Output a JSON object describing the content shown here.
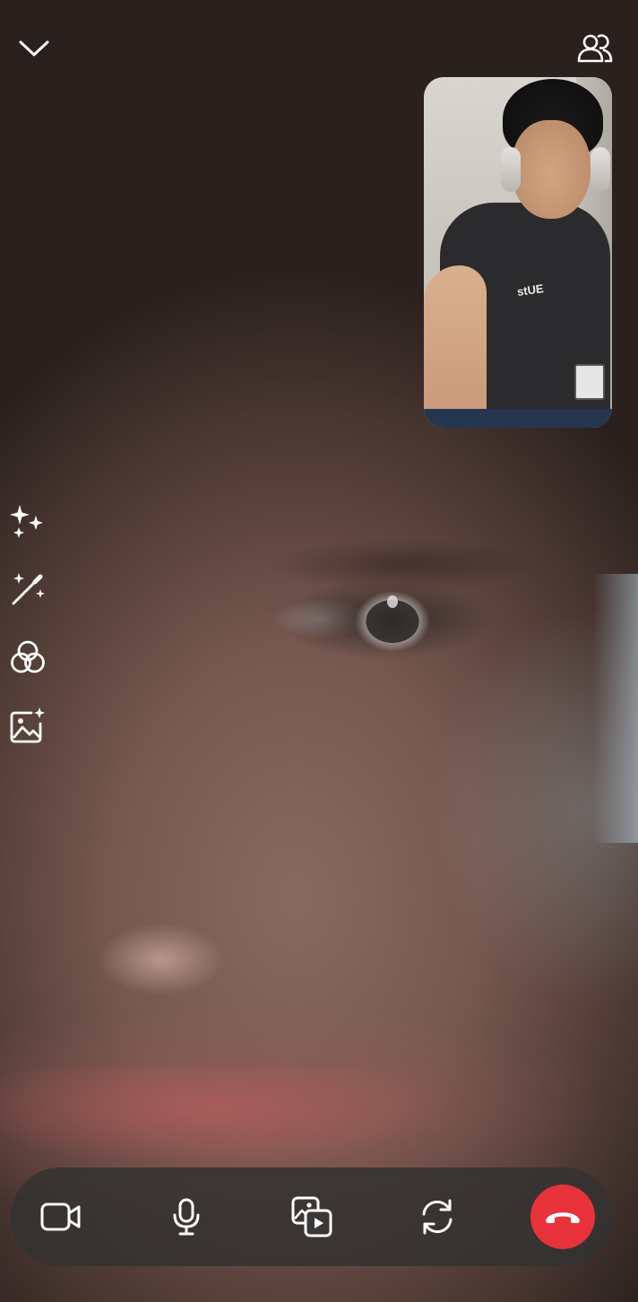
{
  "top_bar": {
    "minimize_icon": "chevron-down-icon",
    "participants_icon": "people-icon"
  },
  "self_view": {
    "shirt_text": "stUE"
  },
  "side_tools": [
    {
      "id": "effects",
      "icon": "sparkles-icon"
    },
    {
      "id": "magic",
      "icon": "magic-wand-icon"
    },
    {
      "id": "filters",
      "icon": "filters-icon"
    },
    {
      "id": "background",
      "icon": "image-sparkle-icon"
    }
  ],
  "controls": [
    {
      "id": "camera",
      "icon": "video-camera-icon"
    },
    {
      "id": "microphone",
      "icon": "microphone-icon"
    },
    {
      "id": "share-media",
      "icon": "media-share-icon"
    },
    {
      "id": "flip-camera",
      "icon": "flip-camera-icon"
    },
    {
      "id": "end-call",
      "icon": "end-call-icon"
    }
  ],
  "colors": {
    "icon": "#ffffff",
    "end_call": "#e8323a",
    "control_bar": "#343231"
  }
}
